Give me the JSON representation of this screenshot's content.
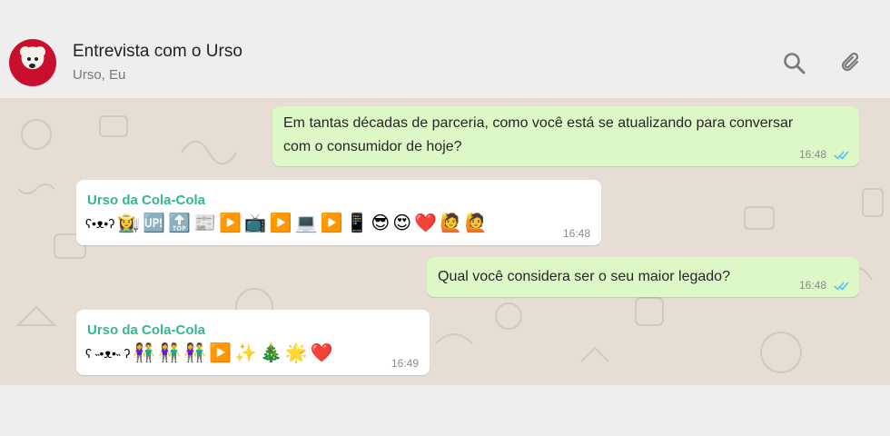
{
  "header": {
    "title": "Entrevista com o Urso",
    "subtitle": "Urso, Eu"
  },
  "icons": {
    "avatar": "polar-bear-avatar",
    "search": "search-icon",
    "attach": "paperclip-icon",
    "read_receipt": "double-check-icon"
  },
  "colors": {
    "outgoing_bubble": "#dcf8c6",
    "incoming_bubble": "#ffffff",
    "sender_name": "#35b592",
    "read_ticks": "#4fc3f7",
    "chat_background": "#e6ddd4"
  },
  "messages": [
    {
      "direction": "outgoing",
      "text_line1": "Em tantas décadas de parceria, como você está se atualizando para conversar",
      "text_line2": "com o consumidor de hoje?",
      "time": "16:48"
    },
    {
      "direction": "incoming",
      "sender": "Urso da Cola-Cola",
      "kaomoji": "ʕ•ᴥ•ʔ",
      "emojis": [
        "👩‍🌾",
        "🆙",
        "🔝",
        "📰",
        "▶️",
        "📺",
        "▶️",
        "💻",
        "▶️",
        "📱",
        "😎",
        "😍",
        "❤️",
        "🙋",
        "🙋"
      ],
      "time": "16:48"
    },
    {
      "direction": "outgoing",
      "text": "Qual você considera ser o seu maior legado?",
      "time": "16:48"
    },
    {
      "direction": "incoming",
      "sender": "Urso da Cola-Cola",
      "kaomoji": "ʕ ˵•ᴥ•˵ ʔ",
      "emojis": [
        "👫",
        "👫",
        "👫",
        "▶️",
        "✨",
        "🎄",
        "🌟",
        "❤️"
      ],
      "time": "16:49"
    }
  ]
}
